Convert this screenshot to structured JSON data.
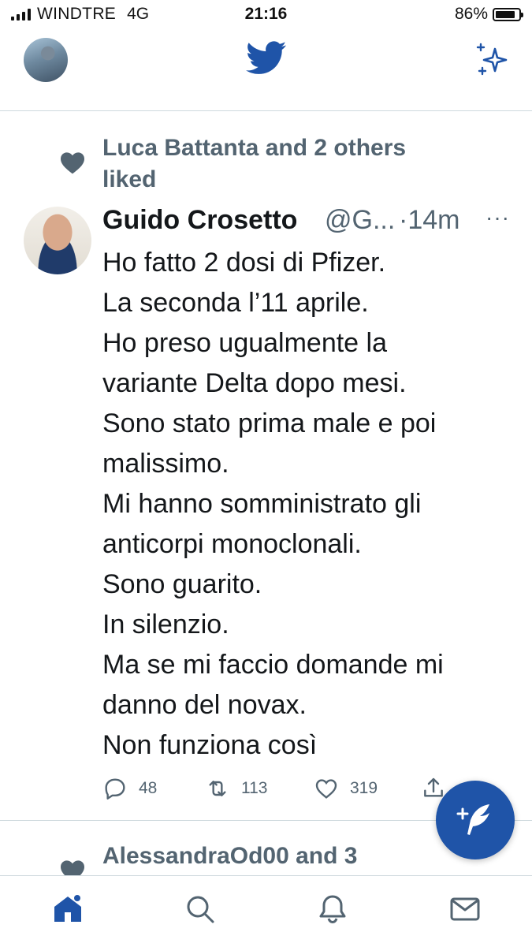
{
  "status_bar": {
    "carrier": "WINDTRE",
    "network": "4G",
    "time": "21:16",
    "battery_percent_label": "86%",
    "battery_level": 0.86
  },
  "header": {
    "profile_icon": "profile-avatar",
    "logo_icon": "twitter-bird-icon",
    "sparkle_icon": "sparkle-icon"
  },
  "tweet": {
    "social_context": "Luca Battanta and 2 others liked",
    "author_name": "Guido Crosetto",
    "author_handle": "@G...",
    "time": "·14m",
    "more": "···",
    "lines": [
      "Ho fatto 2 dosi di Pfizer.",
      "La seconda l’11 aprile.",
      "Ho preso ugualmente la",
      "variante Delta dopo mesi.",
      "Sono stato prima male e poi",
      "malissimo.",
      "Mi hanno somministrato gli",
      "anticorpi monoclonali.",
      "Sono guarito.",
      "In silenzio.",
      "Ma se mi faccio domande mi",
      "danno del novax.",
      "Non funziona così"
    ],
    "actions": {
      "reply_count": "48",
      "retweet_count": "113",
      "like_count": "319"
    }
  },
  "next_tweet": {
    "social_context": "AlessandraOd00 and 3"
  },
  "tabbar": {
    "items": [
      "home-icon",
      "search-icon",
      "bell-icon",
      "mail-icon"
    ]
  },
  "colors": {
    "brand": "#1f54a8",
    "secondary_text": "#536471",
    "primary_text": "#14171a"
  }
}
